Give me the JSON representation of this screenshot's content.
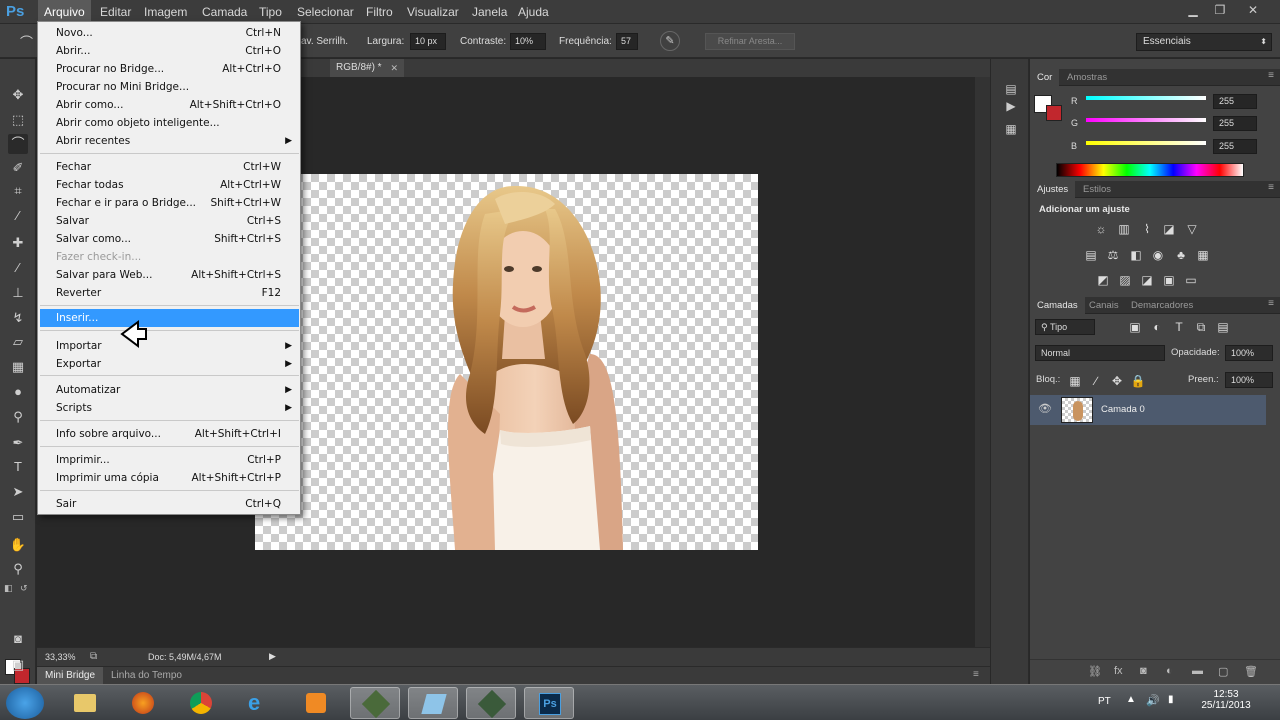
{
  "app": {
    "logo": "Ps"
  },
  "menubar": {
    "items": [
      "Arquivo",
      "Editar",
      "Imagem",
      "Camada",
      "Tipo",
      "Selecionar",
      "Filtro",
      "Visualizar",
      "Janela",
      "Ajuda"
    ],
    "open": "Arquivo"
  },
  "window_controls": {
    "minimize": "▁",
    "restore": "❐",
    "close": "✕"
  },
  "options_bar": {
    "antialias_label": "av. Serrilh.",
    "width_label": "Largura:",
    "width_value": "10 px",
    "contrast_label": "Contraste:",
    "contrast_value": "10%",
    "frequency_label": "Frequência:",
    "frequency_value": "57",
    "refine_edge": "Refinar Aresta...",
    "workspace": "Essenciais"
  },
  "document": {
    "tab_title": "RGB/8#) *",
    "zoom": "33,33%",
    "doc_size": "Doc: 5,49M/4,67M"
  },
  "bottom_tabs": [
    "Mini Bridge",
    "Linha do Tempo"
  ],
  "file_menu": {
    "groups": [
      [
        {
          "label": "Novo...",
          "shortcut": "Ctrl+N"
        },
        {
          "label": "Abrir...",
          "shortcut": "Ctrl+O"
        },
        {
          "label": "Procurar no Bridge...",
          "shortcut": "Alt+Ctrl+O"
        },
        {
          "label": "Procurar no Mini Bridge...",
          "shortcut": ""
        },
        {
          "label": "Abrir como...",
          "shortcut": "Alt+Shift+Ctrl+O"
        },
        {
          "label": "Abrir como objeto inteligente...",
          "shortcut": ""
        },
        {
          "label": "Abrir recentes",
          "shortcut": "",
          "submenu": true
        }
      ],
      [
        {
          "label": "Fechar",
          "shortcut": "Ctrl+W"
        },
        {
          "label": "Fechar todas",
          "shortcut": "Alt+Ctrl+W"
        },
        {
          "label": "Fechar e ir para o Bridge...",
          "shortcut": "Shift+Ctrl+W"
        },
        {
          "label": "Salvar",
          "shortcut": "Ctrl+S"
        },
        {
          "label": "Salvar como...",
          "shortcut": "Shift+Ctrl+S"
        },
        {
          "label": "Fazer check-in...",
          "shortcut": "",
          "disabled": true
        },
        {
          "label": "Salvar para Web...",
          "shortcut": "Alt+Shift+Ctrl+S"
        },
        {
          "label": "Reverter",
          "shortcut": "F12"
        }
      ],
      [
        {
          "label": "Inserir...",
          "shortcut": "",
          "highlighted": true
        }
      ],
      [
        {
          "label": "Importar",
          "shortcut": "",
          "submenu": true
        },
        {
          "label": "Exportar",
          "shortcut": "",
          "submenu": true
        }
      ],
      [
        {
          "label": "Automatizar",
          "shortcut": "",
          "submenu": true
        },
        {
          "label": "Scripts",
          "shortcut": "",
          "submenu": true
        }
      ],
      [
        {
          "label": "Info sobre arquivo...",
          "shortcut": "Alt+Shift+Ctrl+I"
        }
      ],
      [
        {
          "label": "Imprimir...",
          "shortcut": "Ctrl+P"
        },
        {
          "label": "Imprimir uma cópia",
          "shortcut": "Alt+Shift+Ctrl+P"
        }
      ],
      [
        {
          "label": "Sair",
          "shortcut": "Ctrl+Q"
        }
      ]
    ]
  },
  "color_panel": {
    "tabs": [
      "Cor",
      "Amostras"
    ],
    "channels": [
      {
        "label": "R",
        "value": "255",
        "color": "#00ffff"
      },
      {
        "label": "G",
        "value": "255",
        "color": "#ff00ff"
      },
      {
        "label": "B",
        "value": "255",
        "color": "#ffff00"
      }
    ]
  },
  "adjustments_panel": {
    "tabs": [
      "Ajustes",
      "Estilos"
    ],
    "title": "Adicionar um ajuste"
  },
  "layers_panel": {
    "tabs": [
      "Camadas",
      "Canais",
      "Demarcadores"
    ],
    "filter_kind": "Tipo",
    "blend_mode": "Normal",
    "opacity_label": "Opacidade:",
    "opacity_value": "100%",
    "lock_label": "Bloq.:",
    "fill_label": "Preen.:",
    "fill_value": "100%",
    "layers": [
      {
        "name": "Camada 0"
      }
    ]
  },
  "taskbar": {
    "language": "PT",
    "time": "12:53",
    "date": "25/11/2013"
  },
  "colors": {
    "menu_highlight": "#3399ff",
    "background_swatch": "#c1272d",
    "layer_selected": "#4d5a6e"
  }
}
